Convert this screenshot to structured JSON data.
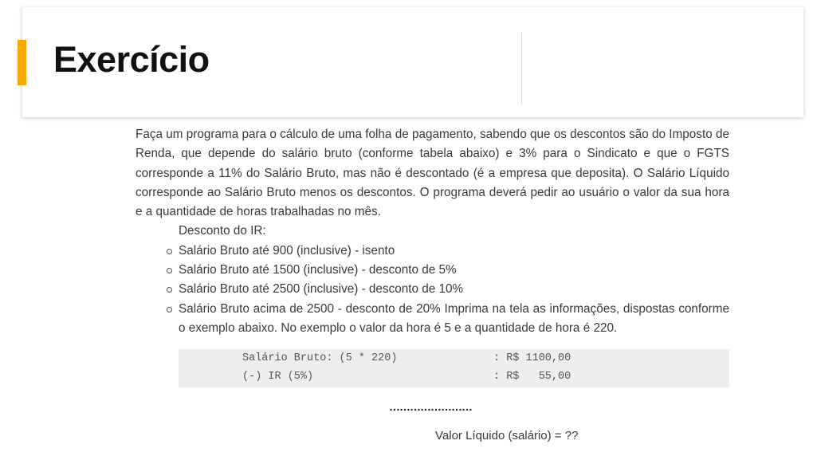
{
  "header": {
    "title": "Exercício",
    "accent_color": "#f6a800"
  },
  "content": {
    "intro": "Faça um programa para o cálculo de uma folha de pagamento, sabendo que os descontos são do Imposto de Renda, que depende do salário bruto (conforme tabela abaixo) e 3% para o Sindicato e que o FGTS corresponde a 11% do Salário Bruto, mas não é descontado (é a empresa que deposita). O Salário Líquido corresponde ao Salário Bruto menos os descontos. O programa deverá pedir ao usuário o valor da sua hora e a quantidade de horas trabalhadas no mês.",
    "ir_title": "Desconto do IR:",
    "ir_items": [
      "Salário Bruto até 900 (inclusive) - isento",
      "Salário Bruto até 1500 (inclusive) - desconto de 5%",
      "Salário Bruto até 2500 (inclusive) - desconto de 10%",
      "Salário Bruto acima de 2500 - desconto de 20% Imprima na tela as informações, dispostas conforme o exemplo abaixo. No exemplo o valor da hora é 5 e a quantidade de hora é 220."
    ]
  },
  "code": {
    "lines": [
      {
        "label": "Salário Bruto: (5 * 220)",
        "value": ": R$ 1100,00"
      },
      {
        "label": "(-) IR (5%)",
        "value": ": R$   55,00"
      }
    ]
  },
  "footer": {
    "dots": "……………………",
    "result": "Valor Líquido (salário) = ??"
  }
}
